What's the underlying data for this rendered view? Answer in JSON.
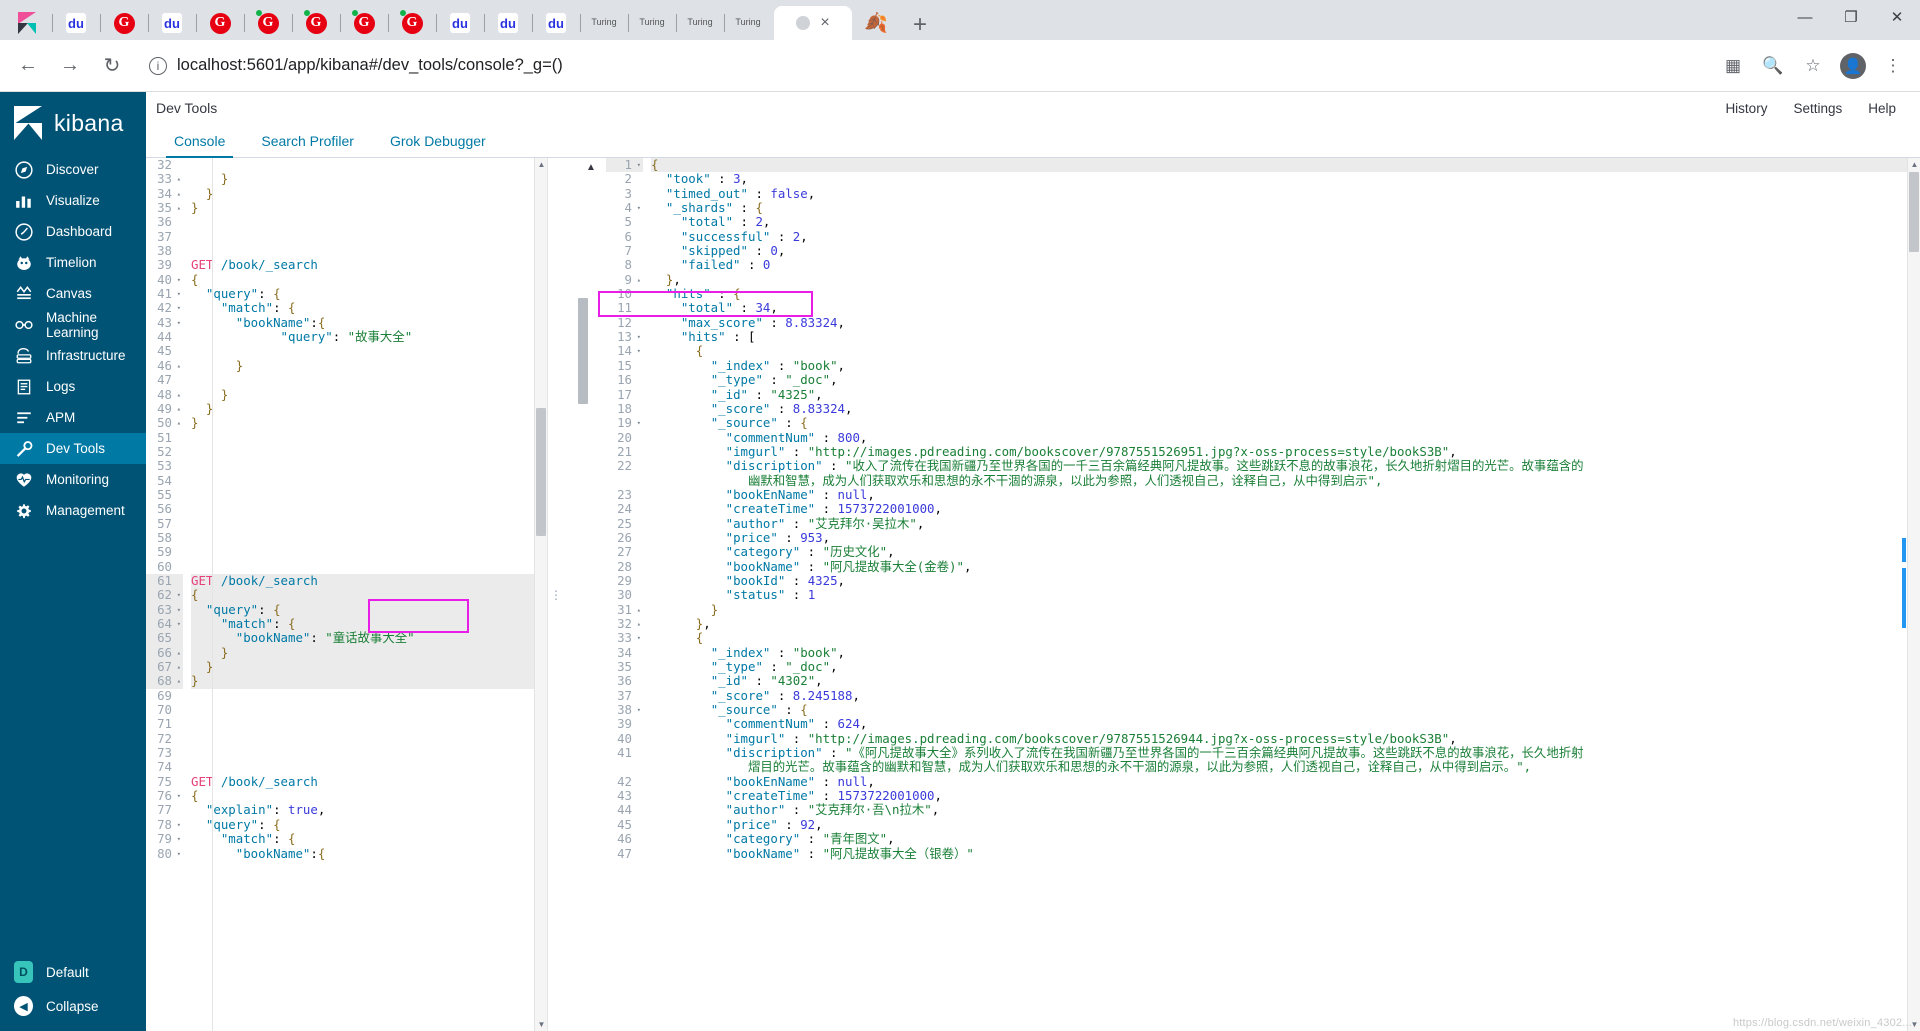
{
  "browser": {
    "tabs": [
      {
        "icon": "kibana-icon",
        "type": "kibana"
      },
      {
        "icon": "baidu-icon",
        "type": "baidu"
      },
      {
        "icon": "google-red-icon",
        "type": "g"
      },
      {
        "icon": "baidu-icon",
        "type": "baidu"
      },
      {
        "icon": "google-red-icon",
        "type": "g"
      },
      {
        "icon": "google-red-icon",
        "type": "gdot"
      },
      {
        "icon": "google-red-icon",
        "type": "gdot"
      },
      {
        "icon": "google-red-icon",
        "type": "gdot"
      },
      {
        "icon": "google-red-icon",
        "type": "gdot"
      },
      {
        "icon": "baidu-icon",
        "type": "baidu"
      },
      {
        "icon": "baidu-icon",
        "type": "baidu"
      },
      {
        "icon": "baidu-icon",
        "type": "baidu"
      },
      {
        "icon": "turing-icon",
        "type": "tur",
        "label": "Turing"
      },
      {
        "icon": "turing-icon",
        "type": "tur",
        "label": "Turing"
      },
      {
        "icon": "turing-icon",
        "type": "tur",
        "label": "Turing"
      },
      {
        "icon": "turing-icon",
        "type": "tur",
        "label": "Turing"
      }
    ],
    "active_tab_close": "×",
    "leaf_tab_icon": "leaf-icon",
    "new_tab_label": "+",
    "window_minimize": "—",
    "window_maximize": "❐",
    "window_close": "✕",
    "nav": {
      "back": "←",
      "forward": "→",
      "reload": "↻",
      "info": "i"
    },
    "url": "localhost:5601/app/kibana#/dev_tools/console?_g=()",
    "toolbar_icons": [
      "translate-icon",
      "search-icon",
      "bookmark-star-icon",
      "profile-avatar-icon",
      "kebab-menu-icon"
    ]
  },
  "sidebar": {
    "brand": "kibana",
    "items": [
      {
        "label": "Discover",
        "icon": "discover-icon",
        "active": false
      },
      {
        "label": "Visualize",
        "icon": "visualize-icon",
        "active": false
      },
      {
        "label": "Dashboard",
        "icon": "dashboard-icon",
        "active": false
      },
      {
        "label": "Timelion",
        "icon": "timelion-icon",
        "active": false
      },
      {
        "label": "Canvas",
        "icon": "canvas-icon",
        "active": false
      },
      {
        "label": "Machine Learning",
        "icon": "machine-learning-icon",
        "active": false
      },
      {
        "label": "Infrastructure",
        "icon": "infrastructure-icon",
        "active": false
      },
      {
        "label": "Logs",
        "icon": "logs-icon",
        "active": false
      },
      {
        "label": "APM",
        "icon": "apm-icon",
        "active": false
      },
      {
        "label": "Dev Tools",
        "icon": "wrench-icon",
        "active": true
      },
      {
        "label": "Monitoring",
        "icon": "heartbeat-icon",
        "active": false
      },
      {
        "label": "Management",
        "icon": "gear-icon",
        "active": false
      }
    ],
    "space": {
      "badge": "D",
      "label": "Default"
    },
    "collapse": {
      "label": "Collapse",
      "icon": "collapse-left-icon"
    }
  },
  "header": {
    "title": "Dev Tools",
    "links": [
      "History",
      "Settings",
      "Help"
    ]
  },
  "tabs": [
    {
      "label": "Console",
      "active": true
    },
    {
      "label": "Search Profiler",
      "active": false
    },
    {
      "label": "Grok Debugger",
      "active": false
    }
  ],
  "request_editor": {
    "first_line_number": 32,
    "lines": [
      {
        "n": 32,
        "fold": "",
        "text": "",
        "partial": true
      },
      {
        "n": 33,
        "fold": "up",
        "text": "    }"
      },
      {
        "n": 34,
        "fold": "up",
        "text": "  }"
      },
      {
        "n": 35,
        "fold": "up",
        "text": "}"
      },
      {
        "n": 36,
        "fold": "",
        "text": ""
      },
      {
        "n": 37,
        "fold": "",
        "text": ""
      },
      {
        "n": 38,
        "fold": "",
        "text": ""
      },
      {
        "n": 39,
        "fold": "",
        "text": "GET /book/_search",
        "kind": "request"
      },
      {
        "n": 40,
        "fold": "down",
        "text": "{"
      },
      {
        "n": 41,
        "fold": "down",
        "text": "  \"query\": {"
      },
      {
        "n": 42,
        "fold": "down",
        "text": "    \"match\": {"
      },
      {
        "n": 43,
        "fold": "down",
        "text": "      \"bookName\":{"
      },
      {
        "n": 44,
        "fold": "",
        "text": "            \"query\": \"故事大全\""
      },
      {
        "n": 45,
        "fold": "",
        "text": ""
      },
      {
        "n": 46,
        "fold": "up",
        "text": "      }"
      },
      {
        "n": 47,
        "fold": "",
        "text": ""
      },
      {
        "n": 48,
        "fold": "up",
        "text": "    }"
      },
      {
        "n": 49,
        "fold": "up",
        "text": "  }"
      },
      {
        "n": 50,
        "fold": "up",
        "text": "}"
      },
      {
        "n": 51,
        "fold": "",
        "text": ""
      },
      {
        "n": 52,
        "fold": "",
        "text": ""
      },
      {
        "n": 53,
        "fold": "",
        "text": ""
      },
      {
        "n": 54,
        "fold": "",
        "text": ""
      },
      {
        "n": 55,
        "fold": "",
        "text": ""
      },
      {
        "n": 56,
        "fold": "",
        "text": ""
      },
      {
        "n": 57,
        "fold": "",
        "text": ""
      },
      {
        "n": 58,
        "fold": "",
        "text": ""
      },
      {
        "n": 59,
        "fold": "",
        "text": ""
      },
      {
        "n": 60,
        "fold": "",
        "text": ""
      },
      {
        "n": 61,
        "fold": "",
        "text": "GET /book/_search",
        "kind": "request",
        "selected": true
      },
      {
        "n": 62,
        "fold": "down",
        "text": "{",
        "selected": true
      },
      {
        "n": 63,
        "fold": "down",
        "text": "  \"query\": {",
        "selected": true
      },
      {
        "n": 64,
        "fold": "down",
        "text": "    \"match\": {",
        "selected": true
      },
      {
        "n": 65,
        "fold": "",
        "text": "      \"bookName\": \"童话故事大全\"",
        "selected": true
      },
      {
        "n": 66,
        "fold": "up",
        "text": "    }",
        "selected": true
      },
      {
        "n": 67,
        "fold": "up",
        "text": "  }",
        "selected": true
      },
      {
        "n": 68,
        "fold": "up",
        "text": "}",
        "selected": true
      },
      {
        "n": 69,
        "fold": "",
        "text": ""
      },
      {
        "n": 70,
        "fold": "",
        "text": ""
      },
      {
        "n": 71,
        "fold": "",
        "text": ""
      },
      {
        "n": 72,
        "fold": "",
        "text": ""
      },
      {
        "n": 73,
        "fold": "",
        "text": ""
      },
      {
        "n": 74,
        "fold": "",
        "text": ""
      },
      {
        "n": 75,
        "fold": "",
        "text": "GET /book/_search",
        "kind": "request"
      },
      {
        "n": 76,
        "fold": "down",
        "text": "{"
      },
      {
        "n": 77,
        "fold": "",
        "text": "  \"explain\": true,"
      },
      {
        "n": 78,
        "fold": "down",
        "text": "  \"query\": {"
      },
      {
        "n": 79,
        "fold": "down",
        "text": "    \"match\": {"
      },
      {
        "n": 80,
        "fold": "down",
        "text": "      \"bookName\":{"
      }
    ],
    "play_button": "play-triangle-icon",
    "wrench_button": "wrench-icon",
    "highlight_label": "bookName-query-highlight"
  },
  "response_viewer": {
    "lines": [
      {
        "n": 1,
        "fold": "down",
        "text": "{",
        "selected": true
      },
      {
        "n": 2,
        "fold": "",
        "text": "  \"took\" : 3,"
      },
      {
        "n": 3,
        "fold": "",
        "text": "  \"timed_out\" : false,"
      },
      {
        "n": 4,
        "fold": "down",
        "text": "  \"_shards\" : {"
      },
      {
        "n": 5,
        "fold": "",
        "text": "    \"total\" : 2,"
      },
      {
        "n": 6,
        "fold": "",
        "text": "    \"successful\" : 2,"
      },
      {
        "n": 7,
        "fold": "",
        "text": "    \"skipped\" : 0,"
      },
      {
        "n": 8,
        "fold": "",
        "text": "    \"failed\" : 0"
      },
      {
        "n": 9,
        "fold": "up",
        "text": "  },"
      },
      {
        "n": 10,
        "fold": "",
        "text": "  \"hits\" : {"
      },
      {
        "n": 11,
        "fold": "",
        "text": "    \"total\" : 34,"
      },
      {
        "n": 12,
        "fold": "",
        "text": "    \"max_score\" : 8.83324,"
      },
      {
        "n": 13,
        "fold": "down",
        "text": "    \"hits\" : ["
      },
      {
        "n": 14,
        "fold": "down",
        "text": "      {"
      },
      {
        "n": 15,
        "fold": "",
        "text": "        \"_index\" : \"book\","
      },
      {
        "n": 16,
        "fold": "",
        "text": "        \"_type\" : \"_doc\","
      },
      {
        "n": 17,
        "fold": "",
        "text": "        \"_id\" : \"4325\","
      },
      {
        "n": 18,
        "fold": "",
        "text": "        \"_score\" : 8.83324,"
      },
      {
        "n": 19,
        "fold": "down",
        "text": "        \"_source\" : {"
      },
      {
        "n": 20,
        "fold": "",
        "text": "          \"commentNum\" : 800,"
      },
      {
        "n": 21,
        "fold": "",
        "text": "          \"imgurl\" : \"http://images.pdreading.com/bookscover/9787551526951.jpg?x-oss-process=style/bookS3B\","
      },
      {
        "n": 22,
        "fold": "",
        "text": "          \"discription\" : \"收入了流传在我国新疆乃至世界各国的一千三百余篇经典阿凡提故事。这些跳跃不息的故事浪花，长久地折射熠目的光芒。故事蕴含的",
        "wrap2": "             幽默和智慧，成为人们获取欢乐和思想的永不干涸的源泉，以此为参照，人们透视自己，诠释自己，从中得到启示\","
      },
      {
        "n": 23,
        "fold": "",
        "text": "          \"bookEnName\" : null,"
      },
      {
        "n": 24,
        "fold": "",
        "text": "          \"createTime\" : 1573722001000,"
      },
      {
        "n": 25,
        "fold": "",
        "text": "          \"author\" : \"艾克拜尔·吴拉木\","
      },
      {
        "n": 26,
        "fold": "",
        "text": "          \"price\" : 953,"
      },
      {
        "n": 27,
        "fold": "",
        "text": "          \"category\" : \"历史文化\","
      },
      {
        "n": 28,
        "fold": "",
        "text": "          \"bookName\" : \"阿凡提故事大全(金卷)\","
      },
      {
        "n": 29,
        "fold": "",
        "text": "          \"bookId\" : 4325,"
      },
      {
        "n": 30,
        "fold": "",
        "text": "          \"status\" : 1"
      },
      {
        "n": 31,
        "fold": "up",
        "text": "        }"
      },
      {
        "n": 32,
        "fold": "up",
        "text": "      },"
      },
      {
        "n": 33,
        "fold": "down",
        "text": "      {"
      },
      {
        "n": 34,
        "fold": "",
        "text": "        \"_index\" : \"book\","
      },
      {
        "n": 35,
        "fold": "",
        "text": "        \"_type\" : \"_doc\","
      },
      {
        "n": 36,
        "fold": "",
        "text": "        \"_id\" : \"4302\","
      },
      {
        "n": 37,
        "fold": "",
        "text": "        \"_score\" : 8.245188,"
      },
      {
        "n": 38,
        "fold": "down",
        "text": "        \"_source\" : {"
      },
      {
        "n": 39,
        "fold": "",
        "text": "          \"commentNum\" : 624,"
      },
      {
        "n": 40,
        "fold": "",
        "text": "          \"imgurl\" : \"http://images.pdreading.com/bookscover/9787551526944.jpg?x-oss-process=style/bookS3B\","
      },
      {
        "n": 41,
        "fold": "",
        "text": "          \"discription\" : \"《阿凡提故事大全》系列收入了流传在我国新疆乃至世界各国的一千三百余篇经典阿凡提故事。这些跳跃不息的故事浪花，长久地折射",
        "wrap2": "             熠目的光芒。故事蕴含的幽默和智慧，成为人们获取欢乐和思想的永不干涸的源泉，以此为参照，人们透视自己，诠释自己，从中得到启示。\","
      },
      {
        "n": 42,
        "fold": "",
        "text": "          \"bookEnName\" : null,"
      },
      {
        "n": 43,
        "fold": "",
        "text": "          \"createTime\" : 1573722001000,"
      },
      {
        "n": 44,
        "fold": "",
        "text": "          \"author\" : \"艾克拜尔·吾\\n拉木\","
      },
      {
        "n": 45,
        "fold": "",
        "text": "          \"price\" : 92,"
      },
      {
        "n": 46,
        "fold": "",
        "text": "          \"category\" : \"青年图文\","
      },
      {
        "n": 47,
        "fold": "",
        "text": "          \"bookName\" : \"阿凡提故事大全（银卷）\"",
        "partial": true
      }
    ],
    "highlight_label": "hits-total-highlight",
    "total_hits": 34
  },
  "watermark": "https://blog.csdn.net/weixin_4302..."
}
